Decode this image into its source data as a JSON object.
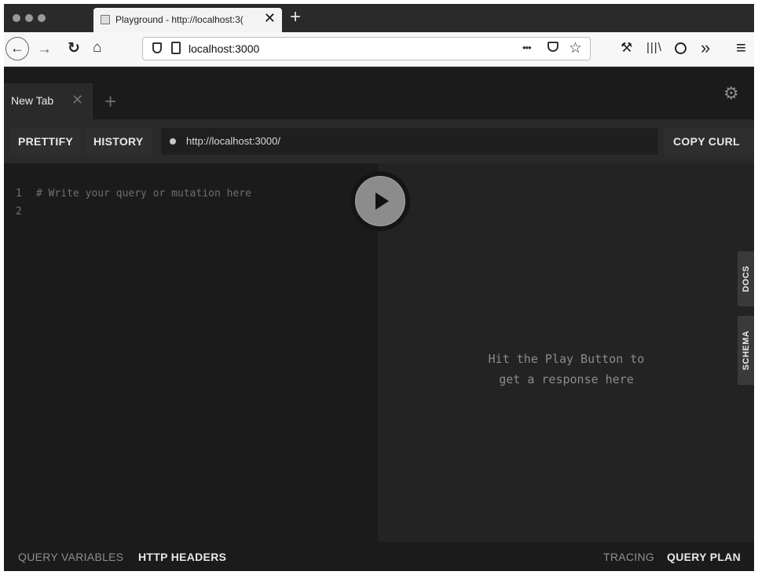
{
  "browser": {
    "tab_title": "Playground - http://localhost:3(",
    "tab_close": "✕",
    "new_tab": "+",
    "address": "localhost:3000",
    "icons": [
      "back-icon",
      "forward-icon",
      "reload-icon",
      "home-icon",
      "shield-icon",
      "page-icon",
      "more-icon",
      "pocket-icon",
      "bookmark-star-icon",
      "wrench-icon",
      "library-icon",
      "info-icon",
      "overflow-icon",
      "menu-icon"
    ],
    "more_glyph": "•••",
    "overflow_glyph": "»",
    "menu_glyph": "≡"
  },
  "playground": {
    "tab_label": "New Tab",
    "tab_close": "✕",
    "add_tab": "+",
    "toolbar": {
      "prettify": "PRETTIFY",
      "history": "HISTORY",
      "endpoint": "http://localhost:3000/",
      "copy_curl": "COPY CURL"
    },
    "editor": {
      "lines": [
        {
          "num": "1",
          "code": "# Write your query or mutation here"
        },
        {
          "num": "2",
          "code": ""
        }
      ]
    },
    "result": {
      "line1": "Hit the Play Button to",
      "line2": "get a response here"
    },
    "side_tabs": {
      "docs": "DOCS",
      "schema": "SCHEMA"
    },
    "bottom": {
      "query_variables": "QUERY VARIABLES",
      "http_headers": "HTTP HEADERS",
      "tracing": "TRACING",
      "query_plan": "QUERY PLAN"
    }
  }
}
